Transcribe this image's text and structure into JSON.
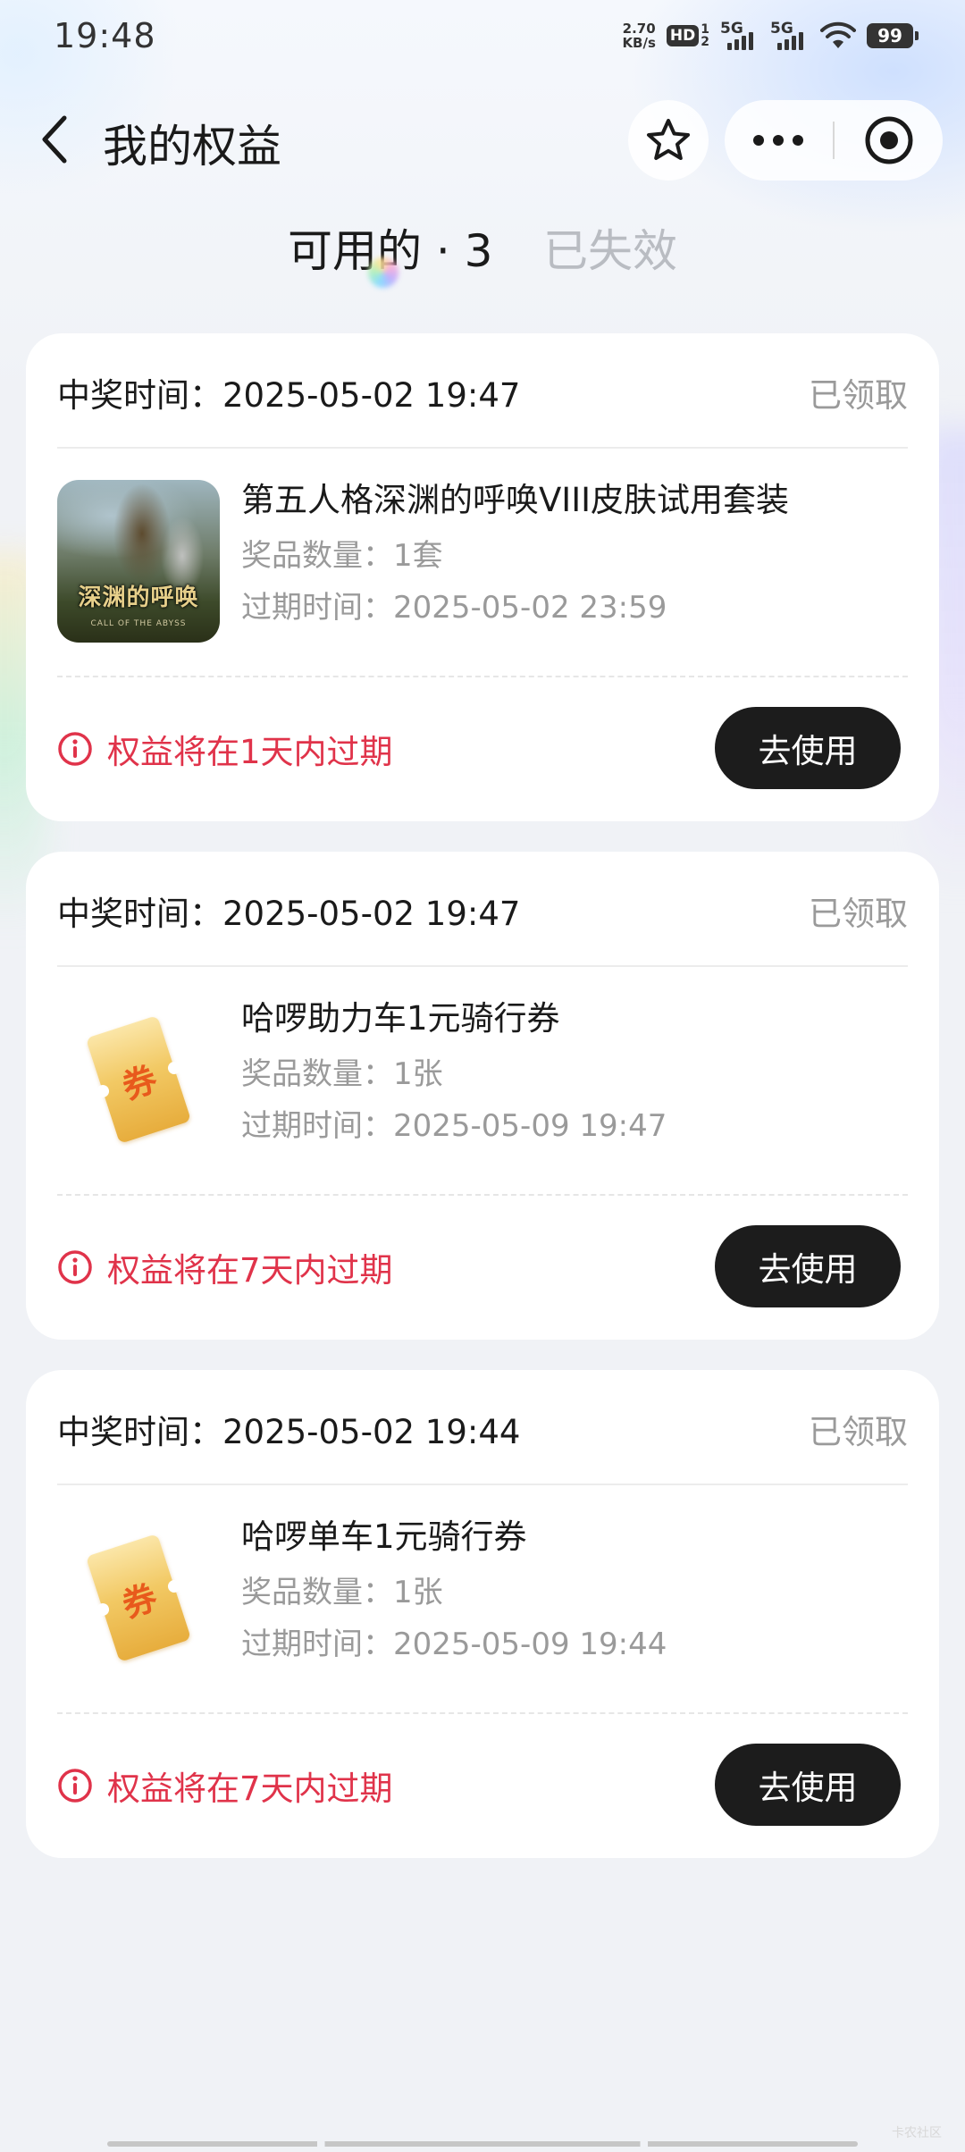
{
  "status_bar": {
    "time": "19:48",
    "net_speed_value": "2.70",
    "net_speed_unit": "KB/s",
    "hd_label": "HD",
    "hd_sub_top": "1",
    "hd_sub_bottom": "2",
    "signal1_label": "5G",
    "signal2_label": "5G",
    "battery": "99"
  },
  "header": {
    "title": "我的权益"
  },
  "tabs": [
    {
      "label": "可用的 · 3",
      "active": true
    },
    {
      "label": "已失效",
      "active": false
    }
  ],
  "cards": [
    {
      "win_time": "中奖时间：2025-05-02 19:47",
      "status": "已领取",
      "image_type": "game-art",
      "image_banner": "深渊的呼唤",
      "image_sub": "CALL OF THE ABYSS",
      "name": "第五人格深渊的呼唤VIII皮肤试用套装",
      "quantity": "奖品数量：1套",
      "expiry": "过期时间：2025-05-02 23:59",
      "warning": "权益将在1天内过期",
      "button": "去使用"
    },
    {
      "win_time": "中奖时间：2025-05-02 19:47",
      "status": "已领取",
      "image_type": "coupon",
      "coupon_char": "券",
      "name": "哈啰助力车1元骑行券",
      "quantity": "奖品数量：1张",
      "expiry": "过期时间：2025-05-09 19:47",
      "warning": "权益将在7天内过期",
      "button": "去使用"
    },
    {
      "win_time": "中奖时间：2025-05-02 19:44",
      "status": "已领取",
      "image_type": "coupon",
      "coupon_char": "券",
      "name": "哈啰单车1元骑行券",
      "quantity": "奖品数量：1张",
      "expiry": "过期时间：2025-05-09 19:44",
      "warning": "权益将在7天内过期",
      "button": "去使用"
    }
  ],
  "watermark": "卡农社区",
  "colors": {
    "accent_warning": "#e0334a",
    "button_bg": "#1c1c1c",
    "page_bg": "#f0f2f6"
  },
  "icons": {
    "back": "chevron-left-icon",
    "star": "star-icon",
    "more": "more-dots-icon",
    "close": "target-close-icon",
    "warning": "info-circle-icon",
    "wifi": "wifi-icon"
  }
}
